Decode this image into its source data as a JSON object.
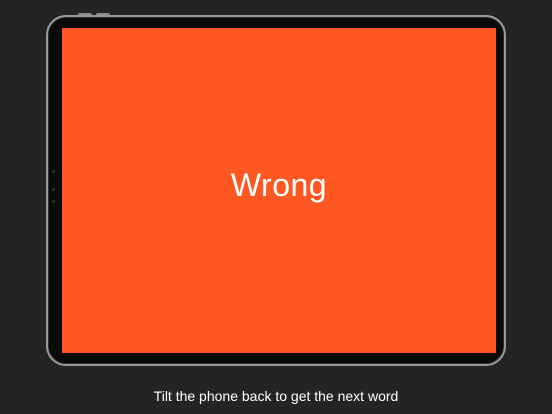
{
  "screen": {
    "result_word": "Wrong",
    "background_color": "#ff5722",
    "text_color": "#ffffff"
  },
  "caption": {
    "text": "Tilt the phone back to get the next word"
  },
  "colors": {
    "page_background": "#242424",
    "device_frame": "#9a9a9a",
    "device_bezel": "#0a0a0a"
  }
}
